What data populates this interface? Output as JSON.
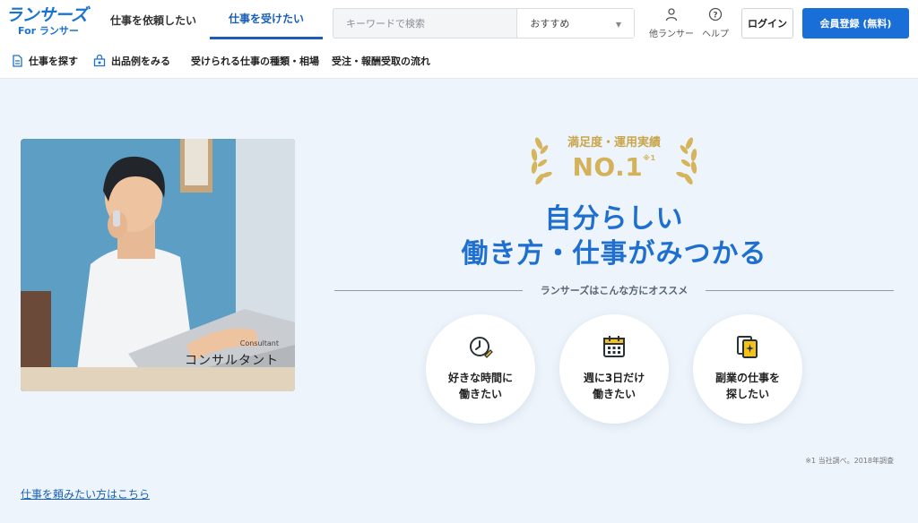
{
  "header": {
    "logo": {
      "main": "ランサーズ",
      "sub": "For ランサー"
    },
    "tabs": [
      {
        "label": "仕事を依頼したい",
        "active": false
      },
      {
        "label": "仕事を受けたい",
        "active": true
      }
    ],
    "search": {
      "placeholder": "キーワードで検索",
      "value": ""
    },
    "sort": {
      "selected": "おすすめ"
    },
    "other_lancers": {
      "label": "他ランサー",
      "icon": "person-icon"
    },
    "help": {
      "label": "ヘルプ",
      "icon": "help-circle-icon"
    },
    "login_label": "ログイン",
    "register_label": "会員登録 (無料)"
  },
  "subnav": {
    "items": [
      {
        "label": "仕事を探す",
        "icon": "document-icon"
      },
      {
        "label": "出品例をみる",
        "icon": "shop-bag-icon"
      },
      {
        "label": "受けられる仕事の種類・相場"
      },
      {
        "label": "受注・報酬受取の流れ"
      }
    ]
  },
  "hero": {
    "photo": {
      "caption_en": "Consultant",
      "caption_jp": "コンサルタント"
    },
    "award": {
      "label": "満足度・運用実績",
      "rank": "NO.1",
      "note": "※1"
    },
    "headline_line1": "自分らしい",
    "headline_line2": "働き方・仕事がみつかる",
    "recommend_label": "ランサーズはこんな方にオススメ",
    "circles": [
      {
        "line1": "好きな時間に",
        "line2": "働きたい",
        "icon": "clock-pen-icon"
      },
      {
        "line1": "週に3日だけ",
        "line2": "働きたい",
        "icon": "calendar-icon"
      },
      {
        "line1": "副業の仕事を",
        "line2": "探したい",
        "icon": "documents-sparkle-icon"
      }
    ],
    "footnote": "※1 当社調べ。2018年調査"
  },
  "client_link": "仕事を頼みたい方はこちら",
  "colors": {
    "brand_blue": "#1e6fd0",
    "award_gold": "#d4b25a",
    "background": "#eef4fb"
  }
}
